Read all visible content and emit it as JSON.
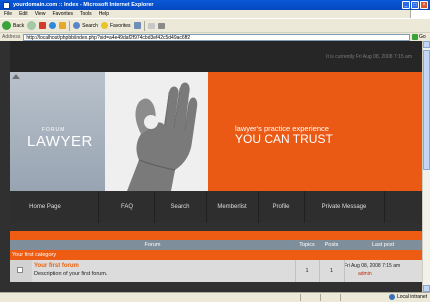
{
  "window": {
    "title": "yourdomain.com :: Index - Microsoft Internet Explorer"
  },
  "menu": [
    "File",
    "Edit",
    "View",
    "Favorites",
    "Tools",
    "Help"
  ],
  "toolbar": {
    "back_label": "Back",
    "search_label": "Search",
    "favorites_label": "Favorites"
  },
  "address": {
    "label": "Address",
    "url": "http://localhost/phpbb/index.php?sid=a4e49daf2f974cbd3ef42c5d49ac6ff2",
    "go_label": "Go"
  },
  "page": {
    "date_text": "It is currently Fri Aug 08, 2008 7:15 am",
    "logo": {
      "sub": "FORUM",
      "main": "LAWYER"
    },
    "tagline": {
      "line1": "lawyer's practice experience",
      "line2": "YOU CAN TRUST"
    },
    "nav": [
      "Home Page",
      "FAQ",
      "Search",
      "Memberlist",
      "Profile",
      "Private Message"
    ]
  },
  "forum_table": {
    "headers": {
      "forum": "Forum",
      "topics": "Topics",
      "posts": "Posts",
      "last_post": "Last post"
    },
    "category": "Your first category",
    "rows": [
      {
        "title": "Your first forum",
        "description": "Description of your first forum.",
        "topics": "1",
        "posts": "1",
        "last_post_date": "Fri Aug 08, 2008 7:15 am",
        "last_post_user": "admin"
      }
    ]
  },
  "statusbar": {
    "zone": "Local intranet"
  },
  "colors": {
    "accent_orange": "#ee5b12",
    "dark_bg": "#303030",
    "xp_blue": "#0a58d8"
  }
}
